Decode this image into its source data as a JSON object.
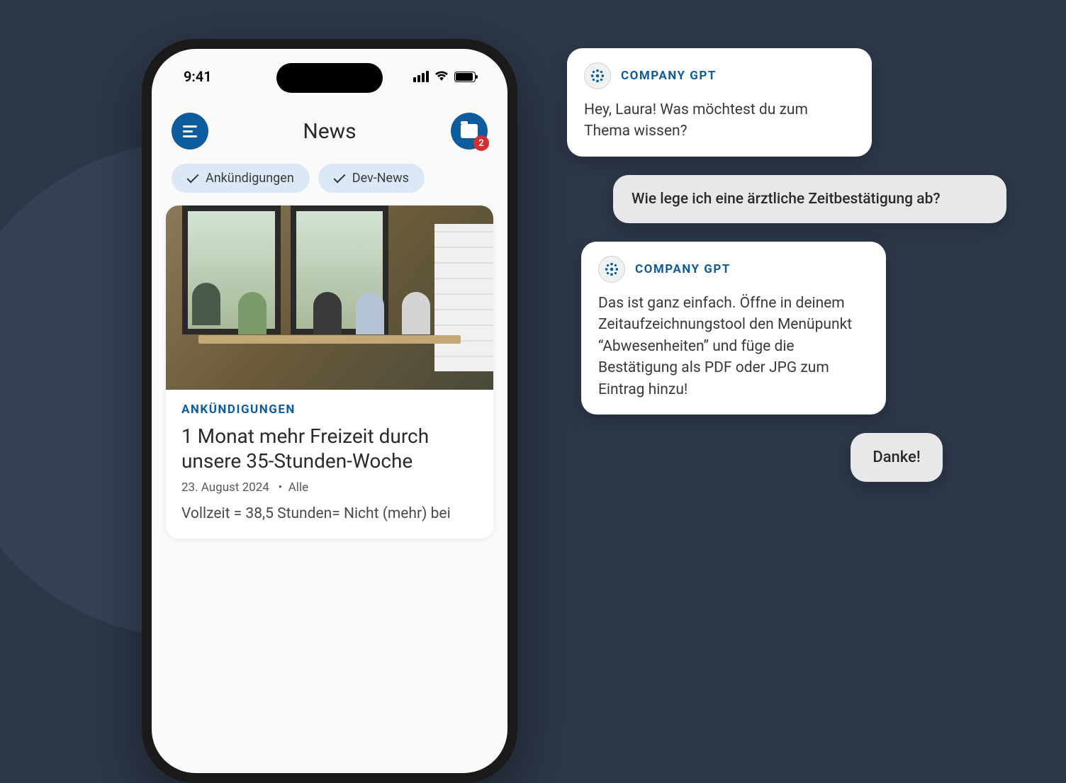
{
  "phone": {
    "status_time": "9:41",
    "header_title": "News",
    "folder_badge": "2",
    "chips": [
      {
        "label": "Ankündigungen"
      },
      {
        "label": "Dev-News"
      }
    ],
    "card": {
      "category": "ANKÜNDIGUNGEN",
      "title": "1 Monat mehr Freizeit durch unsere 35-Stunden-Woche",
      "date": "23. August 2024",
      "audience": "Alle",
      "meta_sep": "•",
      "excerpt": "Vollzeit = 38,5 Stunden= Nicht (mehr) bei"
    }
  },
  "chat": {
    "bot_name": "COMPANY GPT",
    "messages": [
      {
        "role": "bot",
        "text": "Hey, Laura! Was möchtest du zum Thema wissen?"
      },
      {
        "role": "user",
        "text": "Wie lege ich eine ärztliche Zeitbestätigung ab?"
      },
      {
        "role": "bot",
        "text": "Das ist ganz einfach. Öffne in deinem Zeitaufzeichnungstool den Menüpunkt “Abwesenheiten” und füge die Bestätigung als PDF oder JPG zum Eintrag hinzu!"
      },
      {
        "role": "user",
        "text": "Danke!"
      }
    ]
  }
}
